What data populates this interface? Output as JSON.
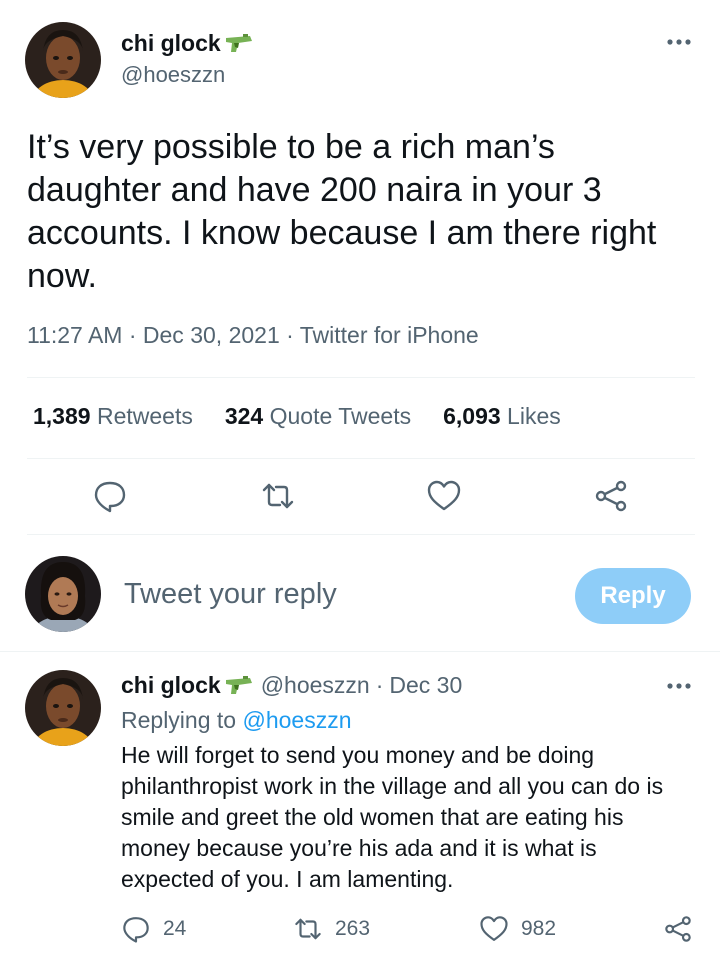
{
  "main_tweet": {
    "display_name": "chi glock",
    "name_icon": "water-pistol-icon",
    "handle": "@hoeszzn",
    "text": "It’s very possible to be a rich man’s daughter and have 200 naira in your 3 accounts. I know because I am there right now.",
    "meta": "11:27 AM · Dec 30, 2021 · Twitter for iPhone",
    "stats": {
      "retweets_count": "1,389",
      "retweets_label": "Retweets",
      "quotes_count": "324",
      "quotes_label": "Quote Tweets",
      "likes_count": "6,093",
      "likes_label": "Likes"
    },
    "actions": [
      "reply-icon",
      "retweet-icon",
      "like-icon",
      "share-icon"
    ]
  },
  "composer": {
    "placeholder": "Tweet your reply",
    "button_label": "Reply"
  },
  "reply_tweet": {
    "display_name": "chi glock",
    "handle": "@hoeszzn",
    "separator": "·",
    "date": "Dec 30",
    "replying_prefix": "Replying to",
    "replying_to": "@hoeszzn",
    "text": "He will forget to send you money and be doing philanthropist work in the village and all you can do is smile and greet the old women that are eating his money because you’re his ada and it is what is expected of you. I am lamenting.",
    "reply_count": "24",
    "retweet_count": "263",
    "like_count": "982"
  },
  "colors": {
    "text": "#0f1419",
    "secondary": "#536471",
    "accent": "#1d9bf0",
    "reply_button_disabled": "#8ecdf8",
    "divider": "#eff3f4"
  }
}
